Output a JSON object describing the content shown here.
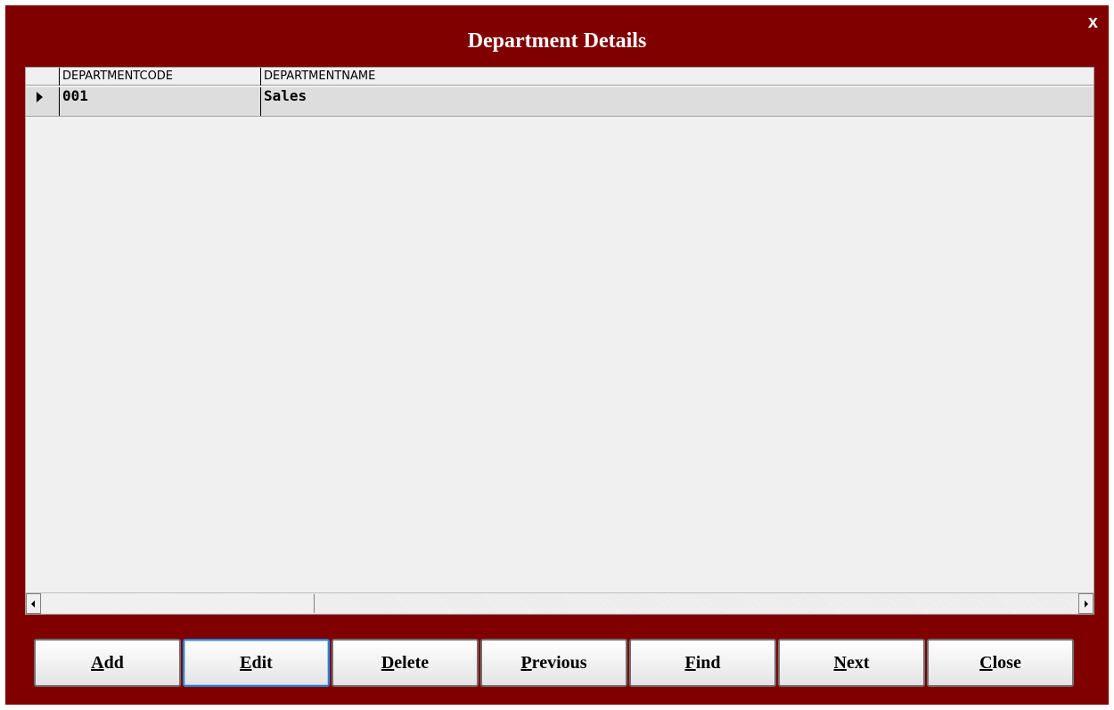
{
  "window": {
    "title": "Department Details",
    "close_label": "x"
  },
  "grid": {
    "columns": [
      "DEPARTMENTCODE",
      "DEPARTMENTNAME"
    ],
    "rows": [
      {
        "code": "001",
        "name": "Sales",
        "selected": true
      }
    ]
  },
  "buttons": {
    "add": {
      "accel": "A",
      "rest": "dd"
    },
    "edit": {
      "accel": "E",
      "rest": "dit"
    },
    "delete": {
      "accel": "D",
      "rest": "elete"
    },
    "previous": {
      "accel": "P",
      "rest": "revious"
    },
    "find": {
      "accel": "F",
      "rest": "ind"
    },
    "next": {
      "accel": "N",
      "rest": "ext"
    },
    "close": {
      "accel": "C",
      "rest": "lose"
    }
  },
  "colors": {
    "window_bg": "#800000",
    "grid_bg": "#f0f0f0",
    "selected_row_bg": "#dddddd",
    "focus_border": "#2f7fd1"
  }
}
